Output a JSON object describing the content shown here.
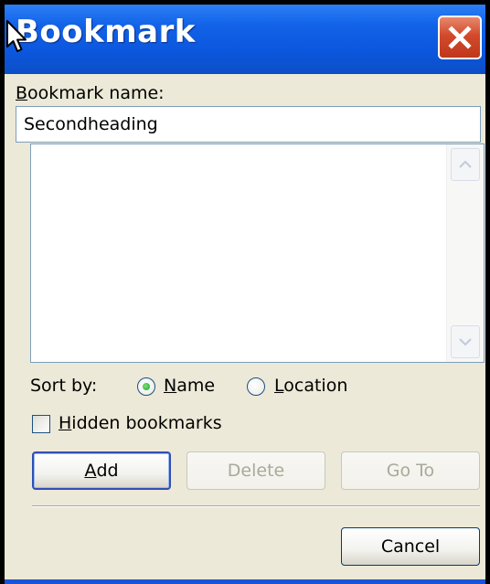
{
  "window": {
    "title": "Bookmark"
  },
  "bookmark_name": {
    "label": "Bookmark name:",
    "value": "Secondheading"
  },
  "bookmark_list": {
    "items": []
  },
  "sort_by": {
    "label": "Sort by:",
    "options": [
      {
        "label": "Name",
        "selected": true
      },
      {
        "label": "Location",
        "selected": false
      }
    ]
  },
  "hidden_bookmarks": {
    "label": "Hidden bookmarks",
    "checked": false
  },
  "buttons": {
    "add": "Add",
    "delete": "Delete",
    "goto": "Go To",
    "cancel": "Cancel"
  },
  "colors": {
    "titlebar": "#0b56dc",
    "dialog_bg": "#ece9d8",
    "close_button": "#d24a2a",
    "radio_dot": "#21a121"
  }
}
